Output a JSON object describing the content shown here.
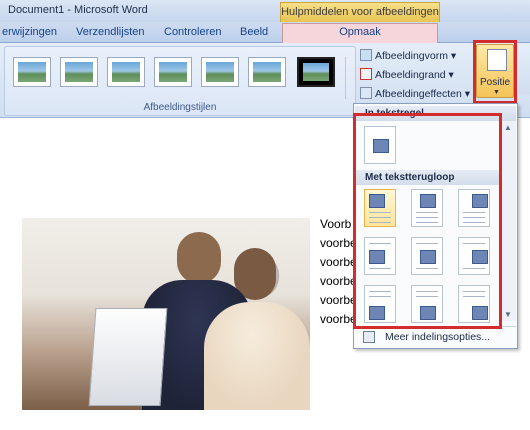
{
  "window": {
    "title": "Document1 - Microsoft Word",
    "contextual_tab_group": "Hulpmiddelen voor afbeeldingen"
  },
  "tabs": [
    {
      "label": "erwijzingen"
    },
    {
      "label": "Verzendlijsten"
    },
    {
      "label": "Controleren"
    },
    {
      "label": "Beeld"
    },
    {
      "label": "Opmaak",
      "active": true
    }
  ],
  "ribbon": {
    "styles_group_label": "Afbeeldingstijlen",
    "commands": {
      "shape": "Afbeeldingvorm",
      "border": "Afbeeldingrand",
      "effects": "Afbeeldingeffecten"
    },
    "position_button": "Positie",
    "thumbnail_count": 7
  },
  "position_menu": {
    "inline_header": "In tekstregel",
    "wrap_header": "Met tekstterugloop",
    "more_options": "Meer indelingsopties..."
  },
  "document": {
    "lines": [
      "Voorb",
      "voorbe",
      "voorbe",
      "voorbe",
      "voorbe",
      "voorbe"
    ]
  },
  "colors": {
    "highlight_red": "#d42c2c",
    "contextual_tab": "#f6d6da",
    "position_button": "#f5c357",
    "ribbon_blue": "#d0def1"
  }
}
